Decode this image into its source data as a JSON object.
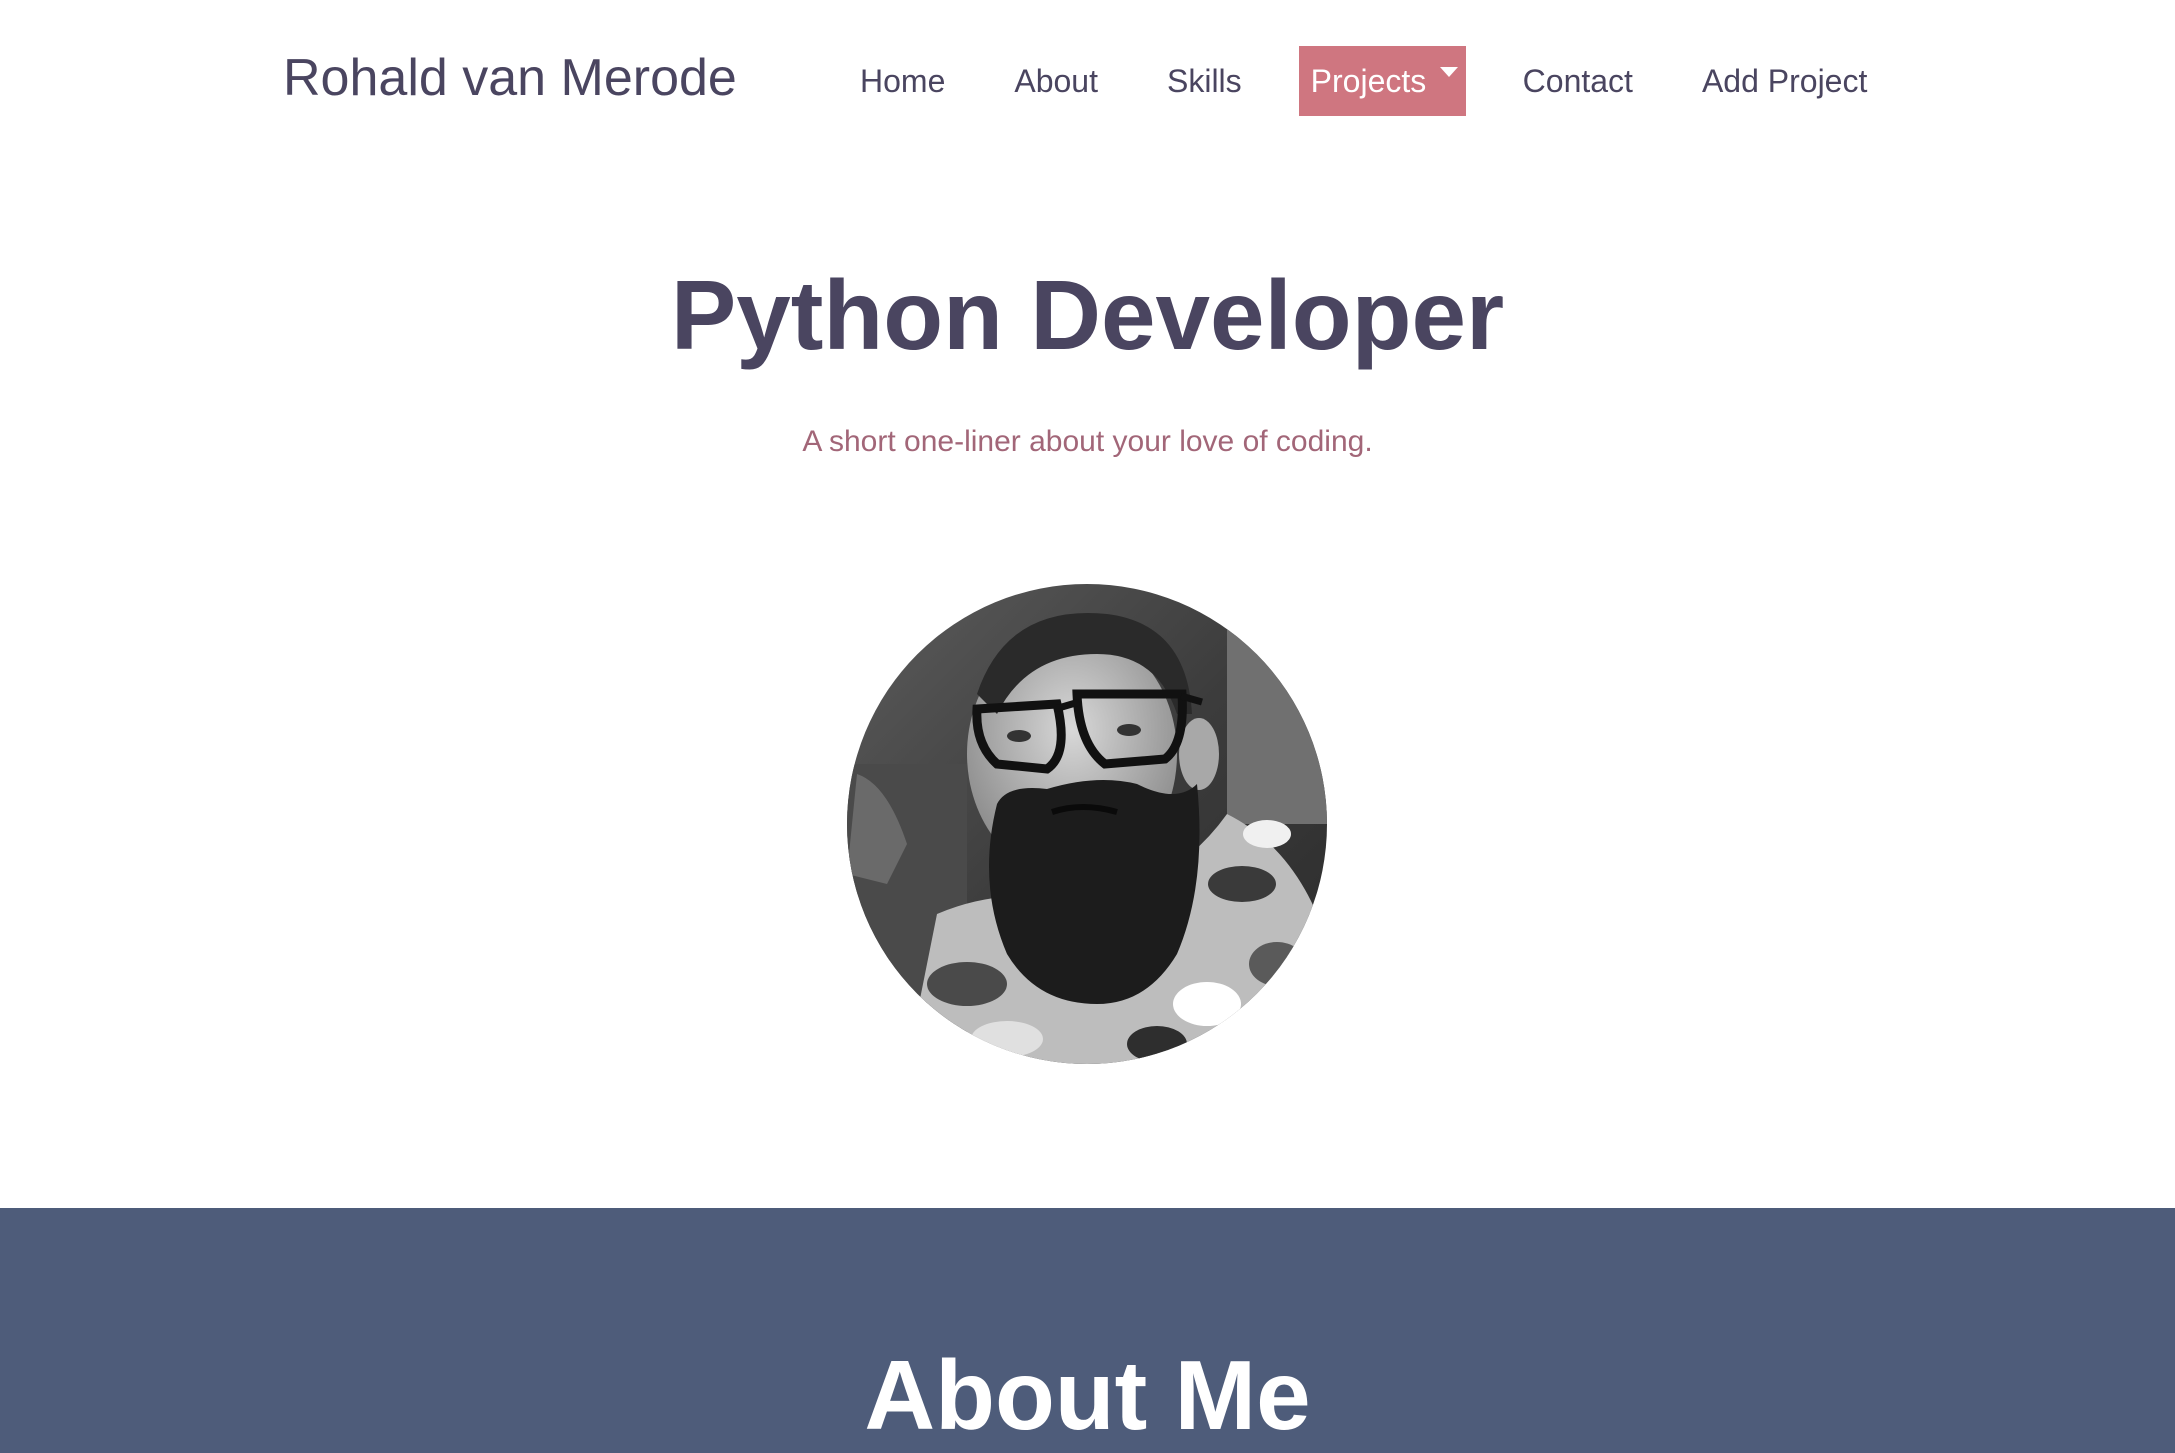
{
  "navbar": {
    "brand": "Rohald van Merode",
    "links": [
      {
        "label": "Home"
      },
      {
        "label": "About"
      },
      {
        "label": "Skills"
      },
      {
        "label": "Projects",
        "active": true,
        "dropdown": true
      },
      {
        "label": "Contact"
      },
      {
        "label": "Add Project"
      }
    ]
  },
  "hero": {
    "title": "Python Developer",
    "subtitle": "A short one-liner about your love of coding.",
    "avatar": "profile-photo"
  },
  "about": {
    "title": "About Me"
  },
  "colors": {
    "text_dark": "#4a4560",
    "accent": "#cf7680",
    "subtitle": "#a26678",
    "section_bg": "#4e5c7a",
    "white": "#ffffff"
  }
}
